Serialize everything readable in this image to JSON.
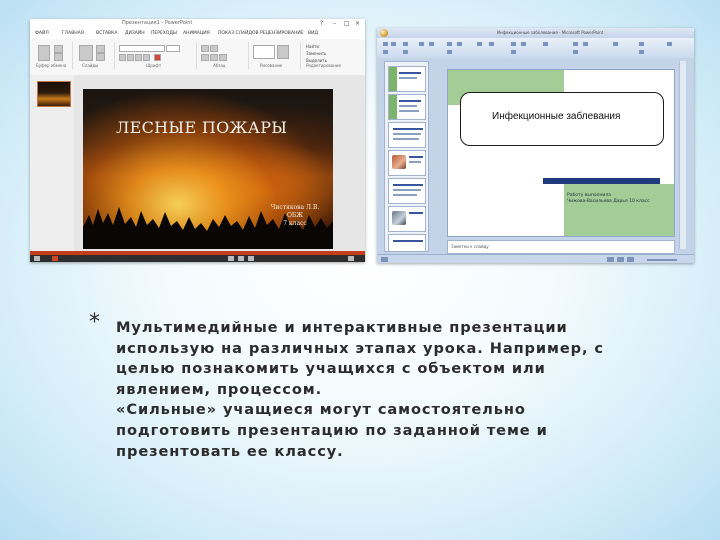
{
  "left_window": {
    "title": "Презентация1 - PowerPoint",
    "tabs": [
      "ФАЙЛ",
      "ГЛАВНАЯ",
      "ВСТАВКА",
      "ДИЗАЙН",
      "ПЕРЕХОДЫ",
      "АНИМАЦИЯ",
      "ПОКАЗ СЛАЙДОВ",
      "РЕЦЕНЗИРОВАНИЕ",
      "ВИД"
    ],
    "ribbon_groups": [
      "Буфер обмена",
      "Слайды",
      "Шрифт",
      "Абзац",
      "Рисование",
      "Редактирование"
    ],
    "ribbon_items": [
      "Найти",
      "Заменить",
      "Выделить"
    ],
    "slide": {
      "title": "ЛЕСНЫЕ ПОЖАРЫ",
      "author": "Чистякова Л.В.",
      "subject": "ОБЖ",
      "grade": "7 класс"
    }
  },
  "right_window": {
    "title": "Инфекционные заболевания - Microsoft PowerPoint",
    "slide": {
      "title": "Инфекционные заблевания",
      "author_line1": "Работу выполнила",
      "author_line2": "Чижова-Васильева Дарья 10 класс"
    },
    "notes_placeholder": "Заметки к слайду"
  },
  "bullet_char": "*",
  "body_lines": [
    "Мультимедийные и интерактивные презентации",
    "использую на различных этапах урока. Например, с",
    "целью познакомить учащихся с объектом или",
    "явлением, процессом.",
    "«Сильные» учащиеся могут самостоятельно",
    "подготовить презентацию по заданной теме и",
    "презентовать ее классу."
  ],
  "colors": {
    "background_center": "#ffffff",
    "background_edge": "#b6def2",
    "ppt2013_accent": "#c43e1c",
    "slide_green": "#a3cc96",
    "slide_bar": "#1e3c7c",
    "text": "#2c2c2c"
  }
}
